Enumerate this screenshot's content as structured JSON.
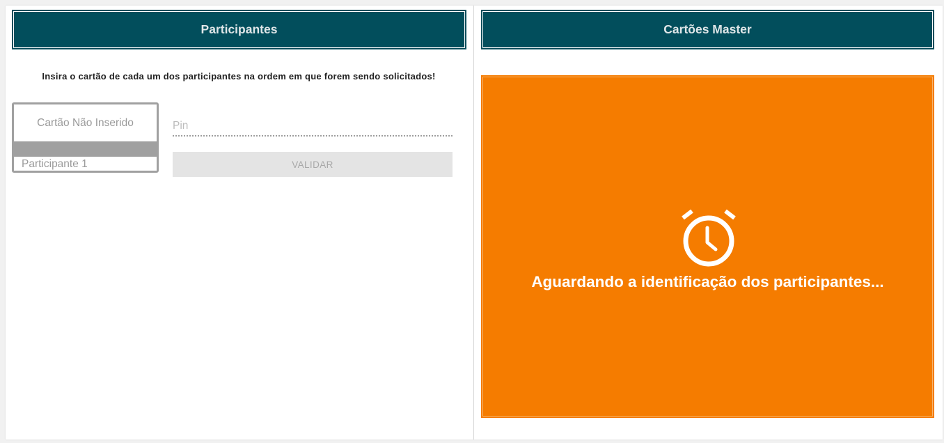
{
  "participants_panel": {
    "title": "Participantes",
    "instructions": "Insira o cartão de cada um dos participantes na ordem em que forem sendo solicitados!",
    "card": {
      "status": "Cartão Não Inserido",
      "participant_label": "Participante 1"
    },
    "pin": {
      "placeholder": "Pin",
      "value": ""
    },
    "validate_label": "VALIDAR"
  },
  "master_panel": {
    "title": "Cartões Master",
    "waiting_icon": "alarm-clock-icon",
    "waiting_message": "Aguardando a identificação dos participantes..."
  },
  "colors": {
    "header_bg": "#024e5c",
    "accent_orange": "#f57c00",
    "card_border": "#a0a0a0",
    "button_disabled_bg": "#e4e4e4"
  }
}
